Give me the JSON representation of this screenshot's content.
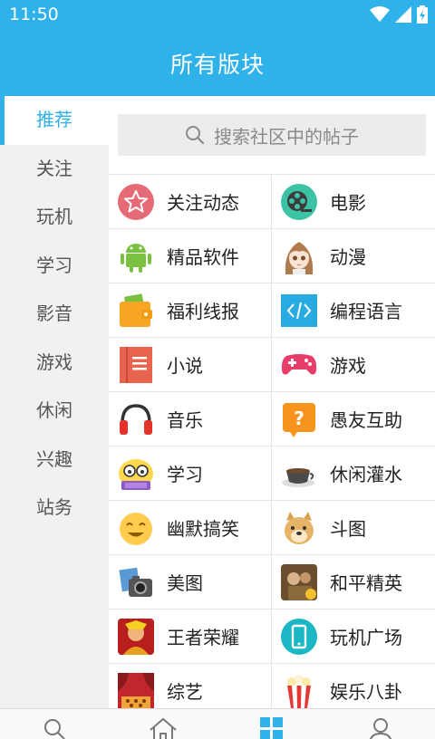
{
  "status_bar": {
    "time": "11:50"
  },
  "header": {
    "title": "所有版块"
  },
  "sidebar": {
    "items": [
      {
        "label": "推荐",
        "active": true
      },
      {
        "label": "关注",
        "active": false
      },
      {
        "label": "玩机",
        "active": false
      },
      {
        "label": "学习",
        "active": false
      },
      {
        "label": "影音",
        "active": false
      },
      {
        "label": "游戏",
        "active": false
      },
      {
        "label": "休闲",
        "active": false
      },
      {
        "label": "兴趣",
        "active": false
      },
      {
        "label": "站务",
        "active": false
      }
    ]
  },
  "search": {
    "placeholder": "搜索社区中的帖子"
  },
  "boards": [
    {
      "label": "关注动态",
      "icon": "star-badge-icon"
    },
    {
      "label": "电影",
      "icon": "film-reel-icon"
    },
    {
      "label": "精品软件",
      "icon": "android-icon"
    },
    {
      "label": "动漫",
      "icon": "anime-girl-icon"
    },
    {
      "label": "福利线报",
      "icon": "wallet-icon"
    },
    {
      "label": "编程语言",
      "icon": "code-icon"
    },
    {
      "label": "小说",
      "icon": "book-icon"
    },
    {
      "label": "游戏",
      "icon": "gamepad-icon"
    },
    {
      "label": "音乐",
      "icon": "headphones-icon"
    },
    {
      "label": "愚友互助",
      "icon": "question-icon"
    },
    {
      "label": "学习",
      "icon": "nerd-emoji-icon"
    },
    {
      "label": "休闲灌水",
      "icon": "coffee-cup-icon"
    },
    {
      "label": "幽默搞笑",
      "icon": "laughing-emoji-icon"
    },
    {
      "label": "斗图",
      "icon": "doge-icon"
    },
    {
      "label": "美图",
      "icon": "photo-camera-icon"
    },
    {
      "label": "和平精英",
      "icon": "pubg-game-icon"
    },
    {
      "label": "王者荣耀",
      "icon": "honor-of-kings-icon"
    },
    {
      "label": "玩机广场",
      "icon": "phone-icon"
    },
    {
      "label": "综艺",
      "icon": "theater-icon"
    },
    {
      "label": "娱乐八卦",
      "icon": "popcorn-icon"
    }
  ],
  "bottom_nav": [
    {
      "icon": "search-icon",
      "active": false
    },
    {
      "icon": "home-icon",
      "active": false
    },
    {
      "icon": "grid-icon",
      "active": true
    },
    {
      "icon": "user-icon",
      "active": false
    }
  ],
  "colors": {
    "accent": "#2fb2ea",
    "sidebar_bg": "#f1f1f1"
  }
}
